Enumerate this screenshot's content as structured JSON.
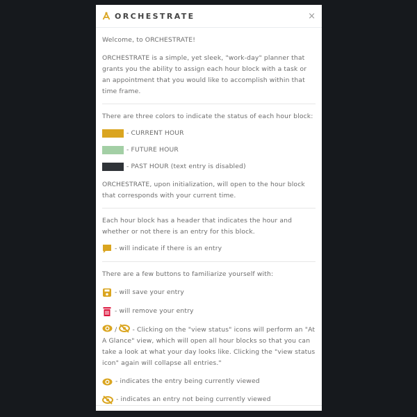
{
  "header": {
    "title": "ORCHESTRATE",
    "logo_icon": "compass-drafting-icon",
    "close_label": "×"
  },
  "colors": {
    "current": "#daa520",
    "future": "#a3cfa5",
    "past": "#2f3338",
    "accent": "#daa520",
    "trash": "#dc143c"
  },
  "welcome": "Welcome, to ORCHESTRATE!",
  "intro": "ORCHESTRATE is a simple, yet sleek, \"work-day\" planner that grants you the ability to assign each hour block with a task or an appointment that you would like to accomplish within that time frame.",
  "colors_intro": "There are three colors to indicate the status of each hour block:",
  "legend": [
    {
      "label": "- CURRENT HOUR"
    },
    {
      "label": "- FUTURE HOUR"
    },
    {
      "label": "- PAST HOUR (text entry is disabled)"
    }
  ],
  "init_text": "ORCHESTRATE, upon initialization, will open to the hour block that corresponds with your current time.",
  "header_text": "Each hour block has a header that indicates the hour and whether or not there is an entry for this block.",
  "comment_text": "- will indicate if there is an entry",
  "buttons_intro": "There are a few buttons to familiarize yourself with:",
  "save_text": "- will save your entry",
  "remove_text": "- will remove your entry",
  "view_sep": "/",
  "view_text": "- Clicking on the \"view status\" icons will perform an \"At A Glance\" view, which will open all hour blocks so that you can take a look at what your day looks like. Clicking the \"view status icon\" again will collapse all entries.\"",
  "viewed_text": "- indicates the entry being currently viewed",
  "not_viewed_text": "- indicates an entry not being currently viewed"
}
